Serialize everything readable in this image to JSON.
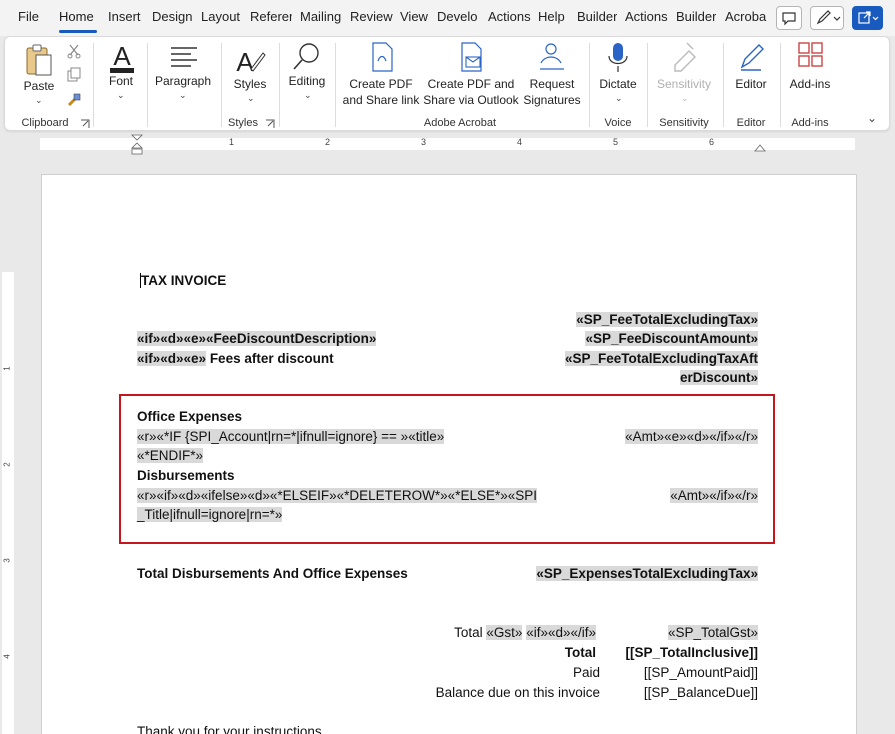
{
  "menu": {
    "tabs": [
      "File",
      "Home",
      "Insert",
      "Design",
      "Layout",
      "Referer",
      "Mailing",
      "Review",
      "View",
      "Develo",
      "Actions",
      "Help",
      "Builder",
      "Actions",
      "Builder",
      "Acroba"
    ],
    "active_tab": "Home"
  },
  "ribbon": {
    "clipboard": {
      "paste": "Paste",
      "group": "Clipboard"
    },
    "font": {
      "label": "Font"
    },
    "paragraph": {
      "label": "Paragraph"
    },
    "styles": {
      "label": "Styles",
      "group": "Styles"
    },
    "editing": {
      "label": "Editing"
    },
    "acrobat": {
      "create_share_1": "Create PDF",
      "create_share_2": "and Share link",
      "create_outlook_1": "Create PDF and",
      "create_outlook_2": "Share via Outlook",
      "request_1": "Request",
      "request_2": "Signatures",
      "group": "Adobe Acrobat"
    },
    "voice": {
      "label": "Dictate",
      "group": "Voice"
    },
    "sensitivity": {
      "label": "Sensitivity",
      "group": "Sensitivity"
    },
    "editor": {
      "label": "Editor",
      "group": "Editor"
    },
    "addins": {
      "label": "Add-ins",
      "group": "Add-ins"
    }
  },
  "ruler": {
    "numbers": [
      "1",
      "2",
      "3",
      "4",
      "5",
      "6"
    ],
    "vnumbers": [
      "1",
      "2",
      "3",
      "4"
    ]
  },
  "document": {
    "title": "TAX INVOICE",
    "fee_total": "«SP_FeeTotalExcludingTax»",
    "fee_discount_desc": "«if»«d»«e»«FeeDiscountDescription»",
    "fee_discount_amount": "«SP_FeeDiscountAmount»",
    "fees_after_prefix": "«if»«d»«e»",
    "fees_after_text": " Fees after discount",
    "fee_total_after_1": "«SP_FeeTotalExcludingTaxAft",
    "fee_total_after_2": "erDiscount»",
    "office_expenses": "Office Expenses",
    "office_line_1": "«r»«*IF {SPI_Account|rn=*|ifnull=ignore} == »«title»",
    "office_line_2": "«*ENDIF*»",
    "office_amt": "«Amt»«e»«d»«/if»«/r»",
    "disbursements": "Disbursements",
    "disb_line_1": "«r»«if»«d»«ifelse»«d»«*ELSEIF»«*DELETEROW*»«*ELSE*»«SPI",
    "disb_line_2": "_Title|ifnull=ignore|rn=*»",
    "disb_amt": "«Amt»«/if»«/r»",
    "total_disb_label": "Total Disbursements And Office Expenses",
    "total_disb_value": "«SP_ExpensesTotalExcludingTax»",
    "total_gst_label": "Total ",
    "gst_field": "«Gst»",
    "gst_if": "«if»«d»«/if»",
    "total_gst_value": "«SP_TotalGst»",
    "total_label": "Total",
    "total_value": "[[SP_TotalInclusive]]",
    "paid_label": "Paid",
    "paid_value": "[[SP_AmountPaid]]",
    "balance_label": "Balance due on this invoice",
    "balance_value": "[[SP_BalanceDue]]",
    "thanks": "Thank you for your instructions"
  },
  "colors": {
    "accent": "#185abd",
    "highlight_box": "#c4161c",
    "field_shading": "#d9d9d9"
  }
}
